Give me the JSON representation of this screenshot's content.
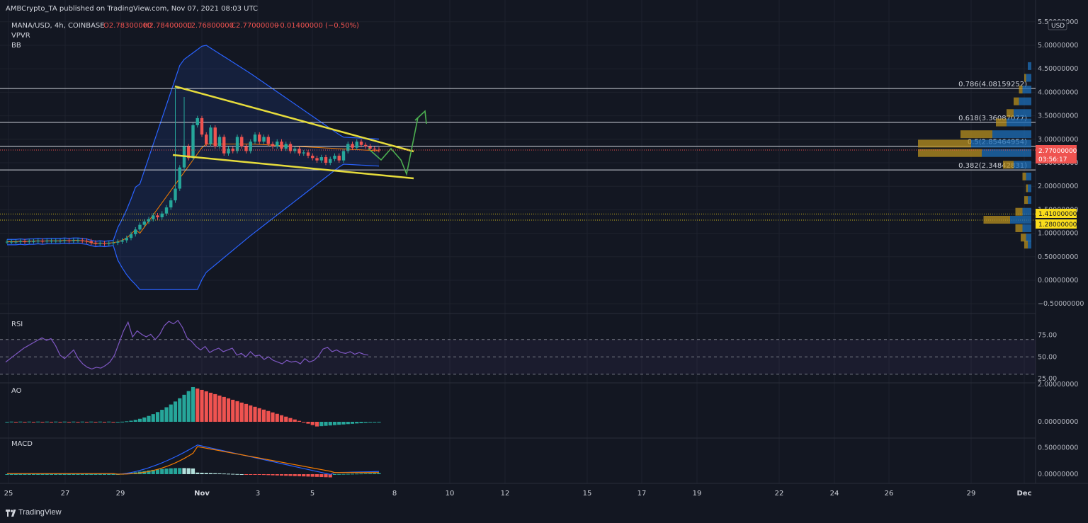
{
  "header": {
    "published": "AMBCrypto_TA published on TradingView.com, Nov 07, 2021 08:03 UTC",
    "symbol": "MANA/USD, 4h, COINBASE",
    "open": "O2.78300000",
    "high": "H2.78400000",
    "low": "L2.76800000",
    "close": "C2.77000000",
    "change": "−0.01400000 (−0.50%)",
    "indicators": [
      "VPVR",
      "BB"
    ],
    "currency": "USD"
  },
  "footer": {
    "brand": "TradingView"
  },
  "colors": {
    "bg": "#131722",
    "up": "#26a69a",
    "down": "#ef5350",
    "trendline": "#e6dc3c",
    "arrow": "#4caf50",
    "bb": "#2962ff",
    "basis": "#f57c00",
    "rsi": "#7e57c2",
    "vp_blue": "#1e6fb8",
    "vp_gold": "#b8901f"
  },
  "chart_data": [
    {
      "type": "candlestick",
      "panel": "main",
      "title": "MANA/USD, 4h, COINBASE",
      "x_ticks": [
        "25",
        "27",
        "29",
        "Nov",
        "3",
        "5",
        "8",
        "10",
        "12",
        "15",
        "17",
        "19",
        "22",
        "24",
        "26",
        "29",
        "Dec"
      ],
      "y_ticks": [
        "5.50000000",
        "5.00000000",
        "4.50000000",
        "4.00000000",
        "3.50000000",
        "3.00000000",
        "2.50000000",
        "2.00000000",
        "1.50000000",
        "1.00000000",
        "0.50000000",
        "0.00000000",
        "−0.50000000"
      ],
      "ylim": [
        -0.65,
        5.55
      ],
      "current_price": "2.77000000",
      "countdown": "03:56:17",
      "price_labels": [
        "1.41000000",
        "1.28000000"
      ],
      "fib_levels": [
        {
          "label": "0.786(4.08159252)",
          "value": 4.08159252
        },
        {
          "label": "0.618(3.36087077)",
          "value": 3.36087077
        },
        {
          "label": "0.5(2.85464954)",
          "value": 2.85464954
        },
        {
          "label": "0.382(2.34842831)",
          "value": 2.34842831
        }
      ],
      "series": [
        {
          "name": "MANA/USD",
          "type": "candlestick"
        },
        {
          "name": "BB",
          "type": "band"
        },
        {
          "name": "VPVR",
          "type": "volume-profile"
        }
      ]
    },
    {
      "type": "line",
      "panel": "rsi",
      "title": "RSI",
      "y_ticks": [
        "75.00",
        "50.00",
        "25.00"
      ],
      "ylim": [
        20,
        100
      ],
      "band": [
        30,
        70
      ],
      "values": [
        44,
        48,
        52,
        56,
        60,
        63,
        66,
        69,
        72,
        69,
        71,
        63,
        52,
        48,
        53,
        58,
        48,
        42,
        38,
        36,
        38,
        37,
        40,
        44,
        52,
        66,
        80,
        90,
        73,
        80,
        76,
        73,
        76,
        70,
        76,
        86,
        91,
        88,
        92,
        84,
        72,
        68,
        62,
        58,
        62,
        55,
        58,
        60,
        56,
        58,
        60,
        52,
        54,
        50,
        56,
        51,
        52,
        47,
        50,
        46,
        44,
        42,
        46,
        44,
        45,
        42,
        48,
        44,
        46,
        51,
        59,
        61,
        56,
        58,
        55,
        54,
        56,
        53,
        55,
        53,
        52
      ]
    },
    {
      "type": "bar",
      "panel": "ao",
      "title": "AO",
      "y_ticks": [
        "2.00000000",
        "0.00000000"
      ],
      "ylim": [
        -0.4,
        2.2
      ]
    },
    {
      "type": "line",
      "panel": "macd",
      "title": "MACD",
      "y_ticks": [
        "0.50000000",
        "0.00000000"
      ],
      "ylim": [
        -0.1,
        0.62
      ]
    }
  ]
}
